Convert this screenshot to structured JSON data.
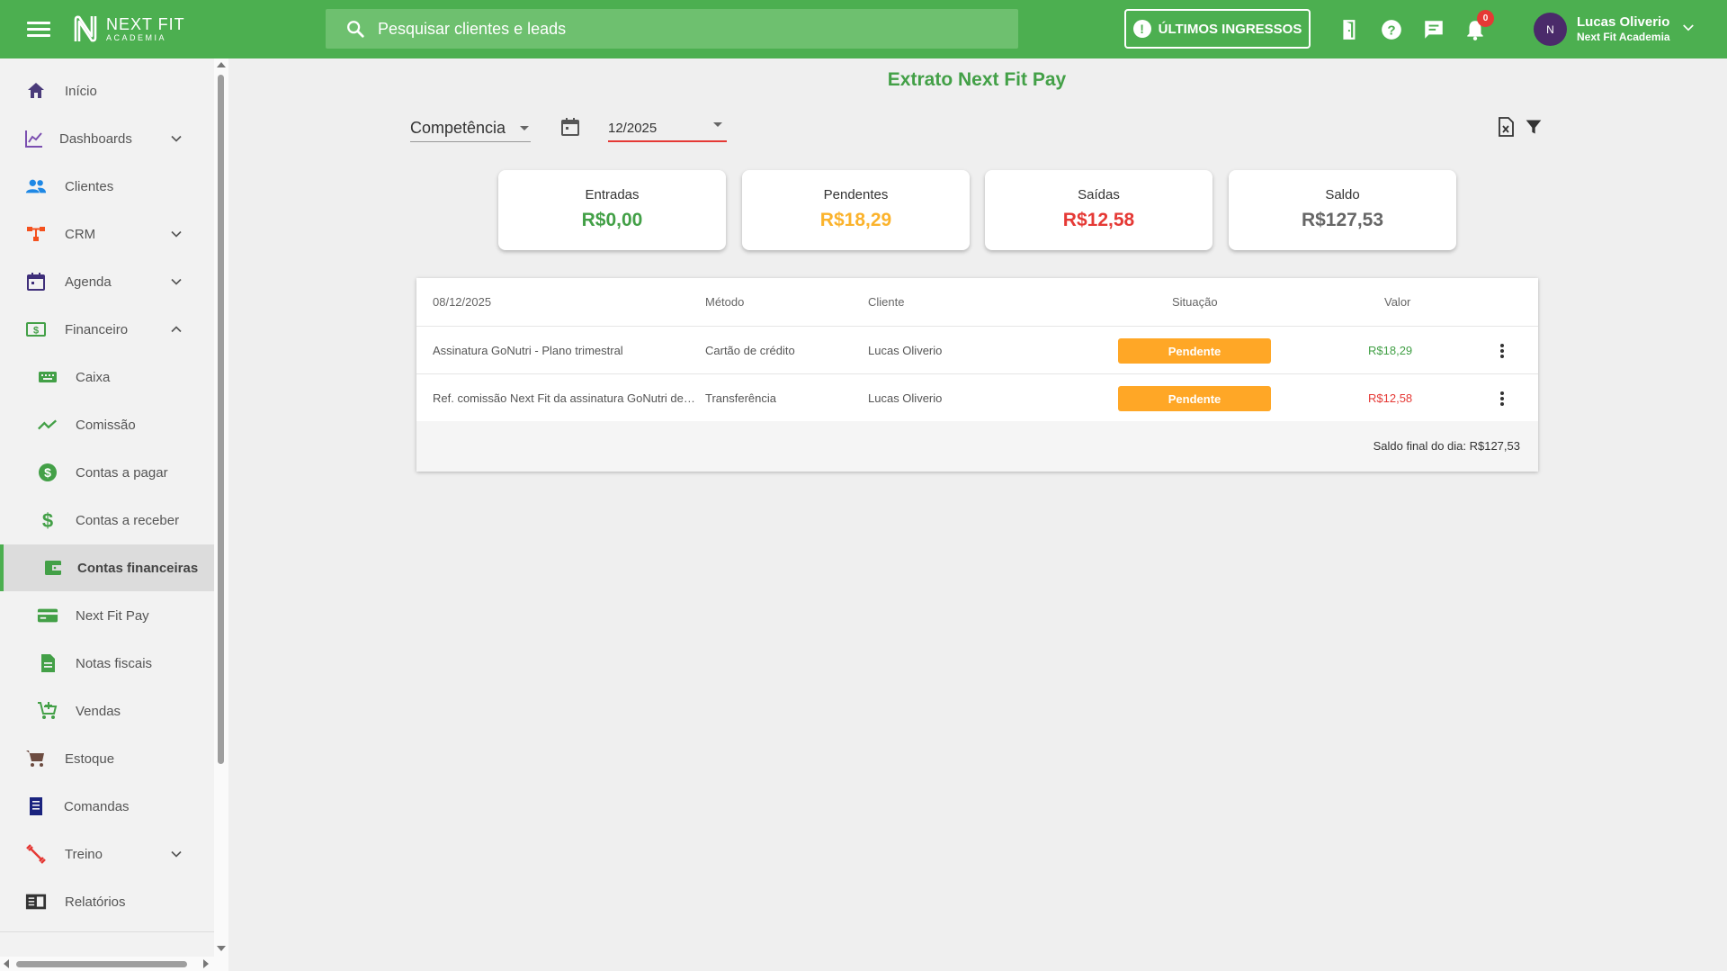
{
  "header": {
    "logo_line1": "NEXT FIT",
    "logo_line2": "ACADEMIA",
    "search_placeholder": "Pesquisar clientes e leads",
    "ingressos_label": "ÚLTIMOS INGRESSOS",
    "notification_count": "0",
    "avatar_initials": "N",
    "user_name": "Lucas Oliverio",
    "user_academy": "Next Fit Academia",
    "accent_color": "#4caf50"
  },
  "sidebar": {
    "items": [
      {
        "label": "Início",
        "icon": "home-icon"
      },
      {
        "label": "Dashboards",
        "icon": "chart-line-icon"
      },
      {
        "label": "Clientes",
        "icon": "people-icon"
      },
      {
        "label": "CRM",
        "icon": "crm-icon"
      },
      {
        "label": "Agenda",
        "icon": "calendar-icon"
      },
      {
        "label": "Financeiro",
        "icon": "money-icon"
      },
      {
        "label": "Caixa",
        "icon": "keyboard-icon"
      },
      {
        "label": "Comissão",
        "icon": "trending-icon"
      },
      {
        "label": "Contas a pagar",
        "icon": "dollar-circle-icon"
      },
      {
        "label": "Contas a receber",
        "icon": "dollar-icon"
      },
      {
        "label": "Contas financeiras",
        "icon": "wallet-icon"
      },
      {
        "label": "Next Fit Pay",
        "icon": "credit-card-icon"
      },
      {
        "label": "Notas fiscais",
        "icon": "document-icon"
      },
      {
        "label": "Vendas",
        "icon": "cart-add-icon"
      },
      {
        "label": "Estoque",
        "icon": "cart-icon"
      },
      {
        "label": "Comandas",
        "icon": "receipt-icon"
      },
      {
        "label": "Treino",
        "icon": "dumbbell-icon"
      },
      {
        "label": "Relatórios",
        "icon": "report-icon"
      }
    ]
  },
  "main": {
    "title": "Extrato Next Fit Pay",
    "period_type": "Competência",
    "period_value": "12/2025",
    "cards": [
      {
        "title": "Entradas",
        "value": "R$0,00",
        "color": "#43a047"
      },
      {
        "title": "Pendentes",
        "value": "R$18,29",
        "color": "#fbb32c"
      },
      {
        "title": "Saídas",
        "value": "R$12,58",
        "color": "#e53935"
      },
      {
        "title": "Saldo",
        "value": "R$127,53",
        "color": "#666666"
      }
    ],
    "table": {
      "headers": {
        "date": "08/12/2025",
        "method": "Método",
        "client": "Cliente",
        "status": "Situação",
        "value": "Valor"
      },
      "rows": [
        {
          "description": "Assinatura GoNutri - Plano trimestral",
          "method": "Cartão de crédito",
          "client": "Lucas Oliverio",
          "status": "Pendente",
          "value": "R$18,29",
          "value_color": "#43a047"
        },
        {
          "description": "Ref. comissão Next Fit da assinatura GoNutri de…",
          "method": "Transferência",
          "client": "Lucas Oliverio",
          "status": "Pendente",
          "value": "R$12,58",
          "value_color": "#e53935"
        }
      ],
      "footer": "Saldo final do dia: R$127,53"
    }
  }
}
